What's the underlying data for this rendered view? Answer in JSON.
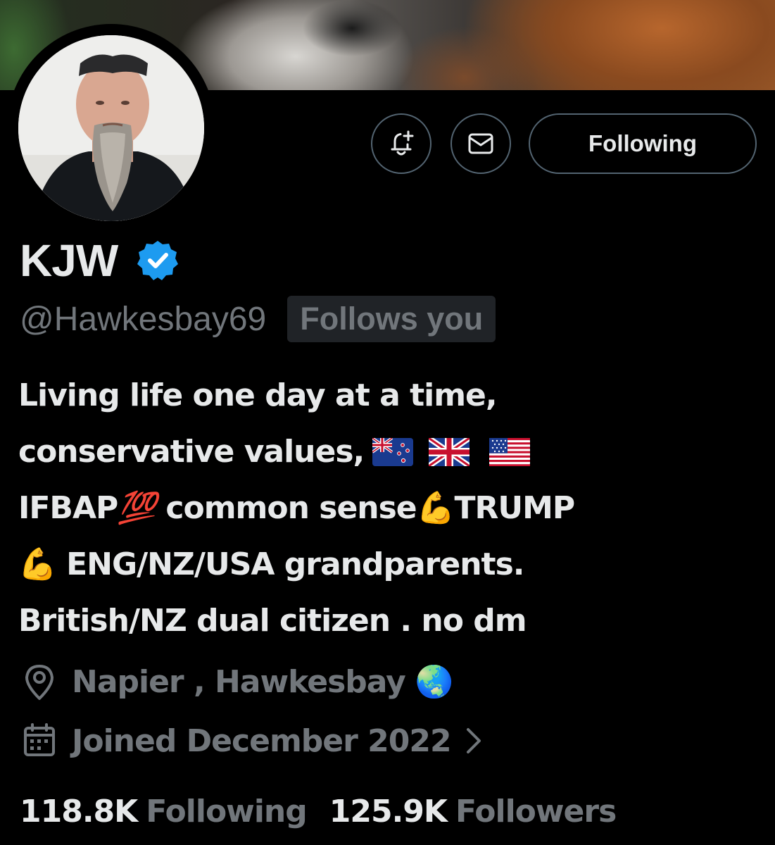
{
  "profile": {
    "display_name": "KJW",
    "handle": "@Hawkesbay69",
    "follows_you_badge": "Follows you",
    "verified": true
  },
  "actions": {
    "notify_icon": "bell-plus-icon",
    "message_icon": "envelope-icon",
    "following_label": "Following"
  },
  "bio": {
    "line1": "Living life one day at a time,",
    "line2": "conservative values,",
    "line2_flags": [
      "New Zealand flag",
      "United Kingdom flag",
      "United States flag"
    ],
    "line3_a": "IFBAP",
    "line3_b": "💯",
    "line3_c": " common sense",
    "line3_d": "💪",
    "line3_e": "TRUMP",
    "line4_a": "💪",
    "line4_b": " ENG/NZ/USA grandparents.",
    "line5": "British/NZ dual citizen . no dm"
  },
  "meta": {
    "location_icon": "location-pin-icon",
    "location": "Napier , Hawkesbay",
    "location_emoji": "🌏",
    "joined_icon": "calendar-icon",
    "joined": "Joined December 2022"
  },
  "stats": {
    "following_count": "118.8K",
    "following_label": "Following",
    "followers_count": "125.9K",
    "followers_label": "Followers"
  },
  "colors": {
    "background": "#000000",
    "text_primary": "#e7e9ea",
    "text_secondary": "#71767b",
    "border": "#536471",
    "verified_blue": "#1d9bf0"
  }
}
